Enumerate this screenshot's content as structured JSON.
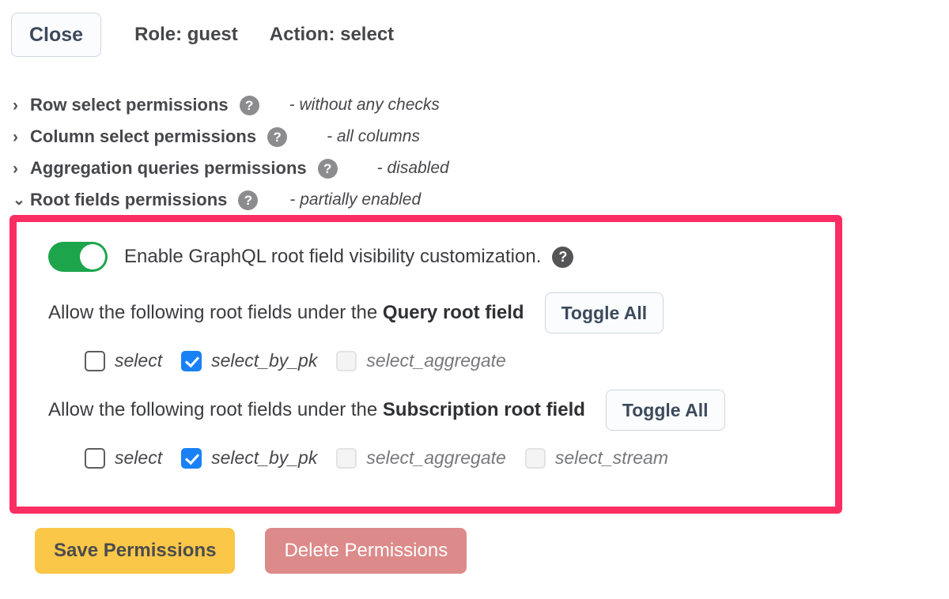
{
  "header": {
    "close_label": "Close",
    "role_label": "Role: guest",
    "action_label": "Action: select"
  },
  "sections": [
    {
      "chevron": "chevron-right-icon",
      "title": "Row select permissions",
      "help": "?",
      "status": "- without any checks",
      "expanded": false
    },
    {
      "chevron": "chevron-right-icon",
      "title": "Column select permissions",
      "help": "?",
      "status": "- all columns",
      "expanded": false
    },
    {
      "chevron": "chevron-right-icon",
      "title": "Aggregation queries permissions",
      "help": "?",
      "status": "- disabled",
      "expanded": false
    },
    {
      "chevron": "chevron-down-icon",
      "title": "Root fields permissions",
      "help": "?",
      "status": "- partially enabled",
      "expanded": true
    }
  ],
  "panel": {
    "highlight_color": "#fb2e63",
    "toggle": {
      "state": "on",
      "color": "#1ca54b",
      "label": "Enable GraphQL root field visibility customization.",
      "help": "?"
    },
    "query_group": {
      "text_prefix": "Allow the following root fields under the ",
      "text_bold": "Query root field",
      "toggle_all_label": "Toggle All",
      "fields": [
        {
          "label": "select",
          "state": "unchecked"
        },
        {
          "label": "select_by_pk",
          "state": "checked"
        },
        {
          "label": "select_aggregate",
          "state": "disabled"
        }
      ]
    },
    "subscription_group": {
      "text_prefix": "Allow the following root fields under the ",
      "text_bold": "Subscription root field",
      "toggle_all_label": "Toggle All",
      "fields": [
        {
          "label": "select",
          "state": "unchecked"
        },
        {
          "label": "select_by_pk",
          "state": "checked"
        },
        {
          "label": "select_aggregate",
          "state": "disabled"
        },
        {
          "label": "select_stream",
          "state": "disabled"
        }
      ]
    }
  },
  "footer": {
    "save_label": "Save Permissions",
    "save_color": "#fbc748",
    "delete_label": "Delete Permissions",
    "delete_color": "#dd8a8a"
  },
  "glyphs": {
    "chevron_right": "›",
    "chevron_down": "⌄"
  }
}
